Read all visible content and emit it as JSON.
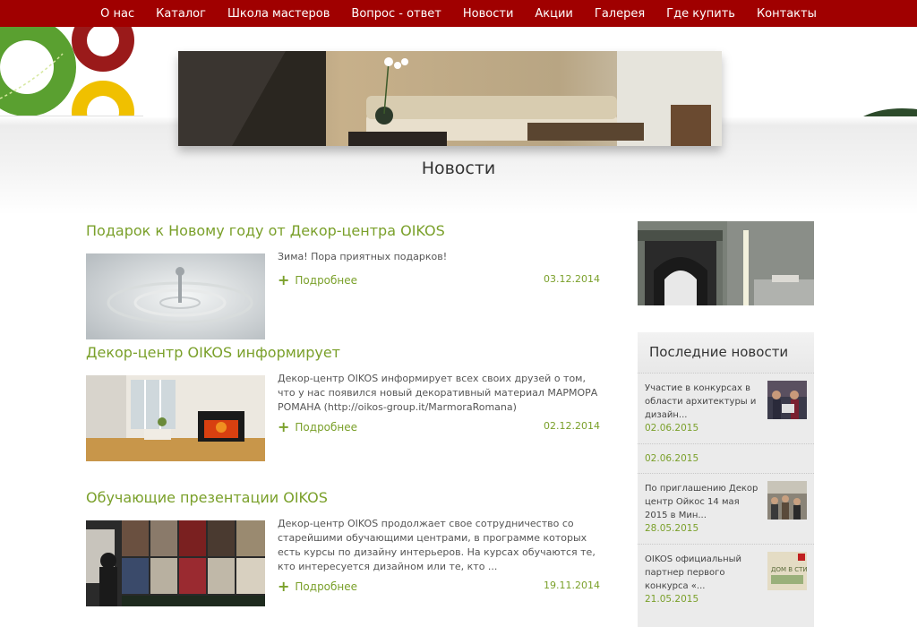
{
  "nav": {
    "items": [
      "О нас",
      "Каталог",
      "Школа мастеров",
      "Вопрос - ответ",
      "Новости",
      "Акции",
      "Галерея",
      "Где купить",
      "Контакты"
    ]
  },
  "page": {
    "title": "Новости"
  },
  "articles": [
    {
      "title": "Подарок к Новому году от Декор-центра OIKOS",
      "text": "Зима! Пора приятных подарков!",
      "more": "Подробнее",
      "date": "03.12.2014"
    },
    {
      "title": "Декор-центр OIKOS информирует",
      "text": "Декор-центр OIKOS информирует всех своих друзей о том, что у нас появился новый декоративный материал МАРМОРА РОМАНА (http://oikos-group.it/MarmoraRomana)",
      "more": "Подробнее",
      "date": "02.12.2014"
    },
    {
      "title": "Обучающие презентации OIKOS",
      "text": "Декор-центр OIKOS продолжает свое сотрудничество со старейшими обучающими центрами, в программе которых есть курсы по дизайну интерьеров. На курсах обучаются те, кто интересуется дизайном или те, кто ...",
      "more": "Подробнее",
      "date": "19.11.2014"
    }
  ],
  "sidebar": {
    "title": "Последние новости",
    "items": [
      {
        "text": "Участие в конкурсах в области архитектуры и дизайн...",
        "date": "02.06.2015"
      },
      {
        "text": "",
        "date": "02.06.2015"
      },
      {
        "text": "По приглашению Декор центр Ойкос 14 мая 2015 в Мин...",
        "date": "28.05.2015"
      },
      {
        "text": "OIKOS официальный партнер первого конкурса «...",
        "date": "21.05.2015"
      }
    ],
    "thumb_caption": "ДОМ В СТИЛЕ «ЭКО»"
  },
  "colors": {
    "nav_bg": "#a00000",
    "accent_green": "#7aa02a"
  }
}
